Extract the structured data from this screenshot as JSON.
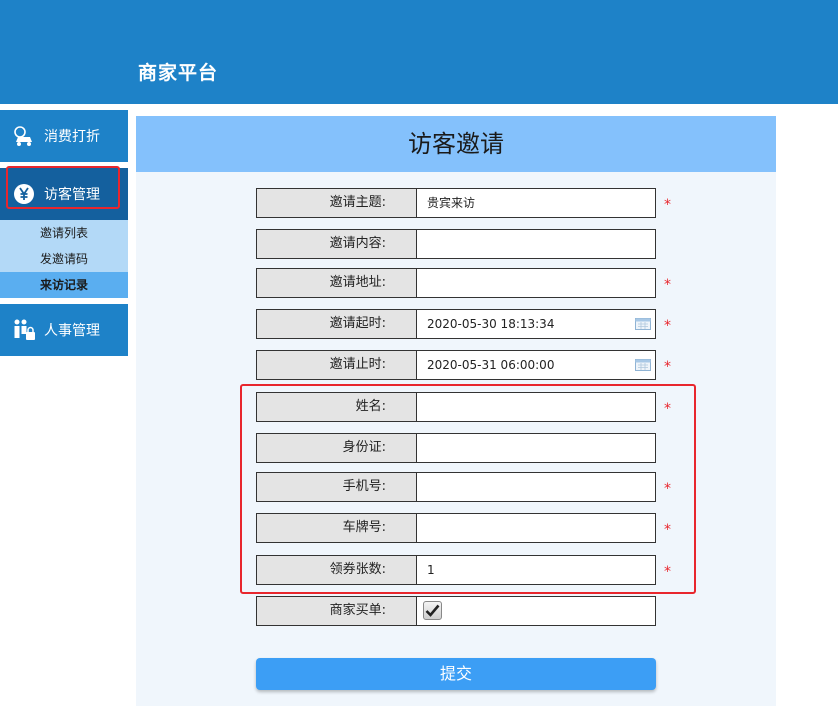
{
  "header": {
    "title": "商家平台"
  },
  "sidebar": {
    "items": [
      {
        "label": "消费打折",
        "icon": "car-discount-icon"
      },
      {
        "label": "访客管理",
        "icon": "yen-icon"
      },
      {
        "label": "人事管理",
        "icon": "people-lock-icon"
      }
    ],
    "sub_items": [
      "邀请列表",
      "发邀请码",
      "来访记录"
    ]
  },
  "form": {
    "title": "访客邀请",
    "fields": [
      {
        "label": "邀请主题:",
        "value": "贵宾来访",
        "required": "*"
      },
      {
        "label": "邀请内容:",
        "value": ""
      },
      {
        "label": "邀请地址:",
        "value": "",
        "required": "*"
      },
      {
        "label": "邀请起时:",
        "value": "2020-05-30 18:13:34",
        "required": "*"
      },
      {
        "label": "邀请止时:",
        "value": "2020-05-31 06:00:00",
        "required": "*"
      },
      {
        "label": "姓名:",
        "value": "",
        "required": "*"
      },
      {
        "label": "身份证:",
        "value": ""
      },
      {
        "label": "手机号:",
        "value": "",
        "required": "*"
      },
      {
        "label": "车牌号:",
        "value": "",
        "required": "*"
      },
      {
        "label": "领券张数:",
        "value": "1",
        "required": "*"
      },
      {
        "label": "商家买单:",
        "checked": true
      }
    ],
    "submit_label": "提交"
  },
  "colors": {
    "header": "#1e82c8",
    "panel_title": "#84c1fc",
    "required": "#e8262d",
    "submit": "#3c9ef5"
  }
}
